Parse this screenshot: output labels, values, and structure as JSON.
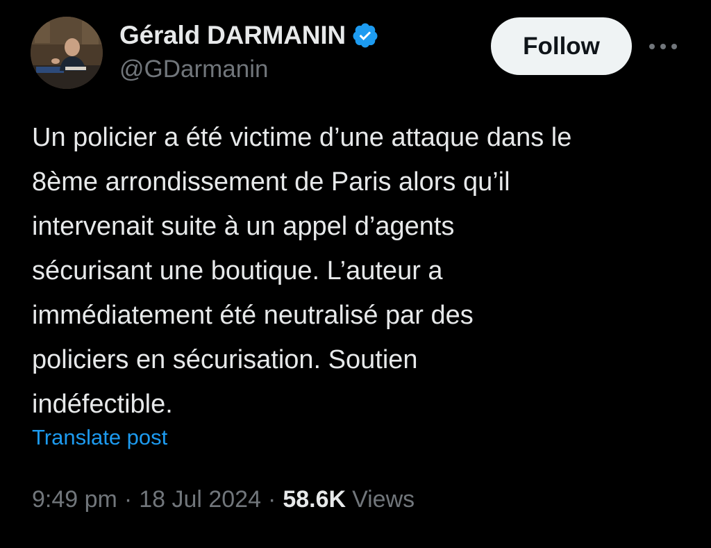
{
  "author": {
    "display_name": "Gérald DARMANIN",
    "handle": "@GDarmanin",
    "verified": true,
    "verified_badge_color": "#1d9bf0",
    "avatar_icon": "profile-photo"
  },
  "actions": {
    "follow_label": "Follow",
    "more_icon": "more-horizontal-icon"
  },
  "post": {
    "text": "Un policier a été victime d’une attaque dans le\n8ème arrondissement de Paris alors qu’il\nintervenait suite à un appel d’agents\nsécurisant une boutique. L’auteur a\nimmédiatement été neutralisé par des\npoliciers en sécurisation. Soutien\nindéfectible.",
    "translate_label": "Translate post"
  },
  "meta": {
    "time": "9:49 pm",
    "separator": "·",
    "date": "18 Jul 2024",
    "views_count": "58.6K",
    "views_label": "Views"
  },
  "colors": {
    "background": "#000000",
    "primary_text": "#e7e9ea",
    "secondary_text": "#71767b",
    "link": "#1d9bf0",
    "follow_button_bg": "#eff3f4",
    "follow_button_text": "#0f1419"
  }
}
